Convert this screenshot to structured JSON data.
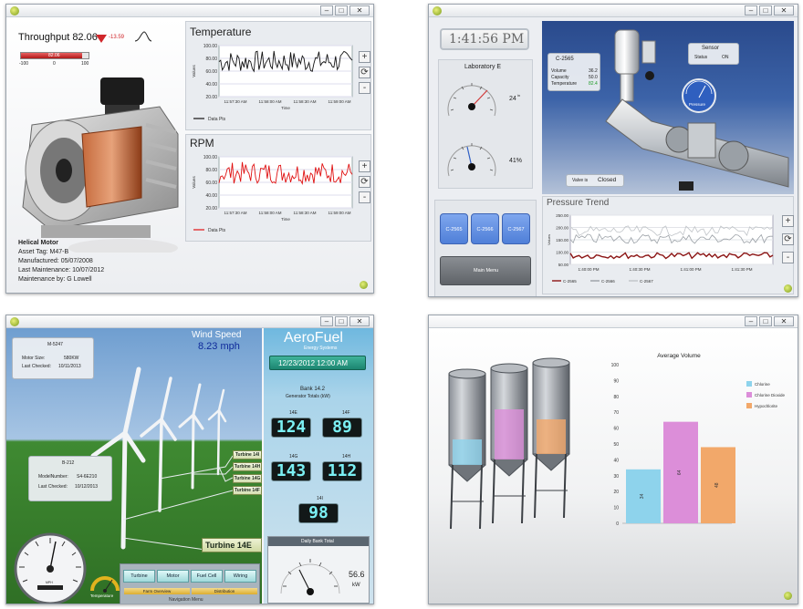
{
  "motor_panel": {
    "throughput_label": "Throughput 82.06",
    "throughput_delta": "-13.59",
    "bar_left": "-100",
    "bar_mid": "0",
    "bar_right": "100",
    "bar_value": "82.06",
    "bar_fraction": 0.91,
    "temperature_title": "Temperature",
    "rpm_title": "RPM",
    "y_axis_label": "Values",
    "x_axis_label": "Time",
    "y_ticks": [
      "100.00",
      "80.00",
      "60.00",
      "40.00",
      "20.00"
    ],
    "x_ticks": [
      "11:57:30 AM",
      "11:58:00 AM",
      "11:58:30 AM",
      "11:59:00 AM"
    ],
    "legend_label": "Data Pts",
    "plus_label": "+",
    "minus_label": "-",
    "motor_title": "Helical Motor",
    "asset_tag": "Asset Tag: M47-B",
    "manufactured": "Manufactured: 05/07/2008",
    "last_maintenance": "Last Maintenance: 10/07/2012",
    "maintenance_by": "Maintenance by: G Lowell",
    "temperature_color": "#111111",
    "rpm_color": "#e01010"
  },
  "lab_panel": {
    "clock": "1:41:56 PM",
    "gauge_title": "Laboratory E",
    "gauge1_value": "24",
    "gauge1_unit": "in",
    "gauge2_value": "41%",
    "tile1": "C-2565",
    "tile2": "C-2566",
    "tile3": "C-2567",
    "main_menu": "Main Menu",
    "tank_label": "C-2565",
    "row1_label": "Volume",
    "row1_value": "36.2",
    "row2_label": "Capacity",
    "row2_value": "50.0",
    "row3_label": "Temperature",
    "row3_value": "82.4",
    "sensor_title": "Sensor",
    "sensor_status_label": "Status",
    "sensor_status_value": "ON",
    "pressure_label": "Pressure",
    "valve_label": "Valve is",
    "valve_value": "Closed",
    "trend_title": "Pressure Trend",
    "trend_y_ticks": [
      "250.00",
      "200.00",
      "150.00",
      "100.00",
      "50.00"
    ],
    "trend_x_ticks": [
      "1:40:00 PM",
      "1:40:30 PM",
      "1:41:00 PM",
      "1:41:30 PM"
    ],
    "trend_y_label": "Values",
    "legend": [
      "C-2565",
      "C-2566",
      "C-2567"
    ],
    "plus_label": "+",
    "minus_label": "-"
  },
  "wind_panel": {
    "tag_id": "M-5247",
    "motor_size_label": "Motor Size:",
    "motor_size_value": "580KW",
    "last_checked_label": "Last Checked:",
    "last_checked_value": "10/11/2013",
    "b_tag_id": "B-212",
    "model_label": "ModelNumber:",
    "model_value": "S4-6E210",
    "b_checked_label": "Last Checked:",
    "b_checked_value": "10/12/2013",
    "wind_title": "Wind Speed",
    "wind_value": "8.23 mph",
    "brand_name": "AeroFuel",
    "brand_sub": "Energy Systems",
    "datetime": "12/23/2012 12:00 AM",
    "bank_title": "Bank 14.2",
    "bank_sub": "Generator Totals (kW)",
    "t14e_label": "14E",
    "t14e_value": "124",
    "t14f_label": "14F",
    "t14f_value": "89",
    "t14g_label": "14G",
    "t14g_value": "143",
    "t14h_label": "14H",
    "t14h_value": "112",
    "t14i_label": "14I",
    "t14i_value": "98",
    "daily_total_label": "Daily Bank Total",
    "daily_total_value": "56.6",
    "daily_total_unit": "kW",
    "turbine_tags": [
      "Turbine 14I",
      "Turbine 14H",
      "Turbine 14G",
      "Turbine 14F"
    ],
    "turbine_selected": "Turbine 14E",
    "temperature_label": "Temperature",
    "nav_buttons": [
      "Turbine",
      "Motor",
      "Fuel Cell",
      "Wiring"
    ],
    "farm_overview": "Farm Overview",
    "distribution": "Distribution",
    "nav_menu": "Navigation Menu",
    "speed_label": "MPH"
  },
  "silo_panel": {
    "chart_data": {
      "type": "bar",
      "title": "Average Volume",
      "categories": [
        "Chlorine",
        "Chlorine Dioxide",
        "Hypochlorite"
      ],
      "values": [
        34,
        64,
        48
      ],
      "data_labels": [
        "34",
        "64",
        "48"
      ],
      "ylim": [
        0,
        100
      ],
      "y_ticks": [
        "100",
        "90",
        "80",
        "70",
        "60",
        "50",
        "40",
        "30",
        "20",
        "10",
        "0"
      ],
      "colors": [
        "#8ed3ec",
        "#dc8ed9",
        "#f2a86a"
      ],
      "legend_position": "top-right",
      "grid": false
    },
    "silo_levels": [
      0.28,
      0.55,
      0.38
    ]
  }
}
